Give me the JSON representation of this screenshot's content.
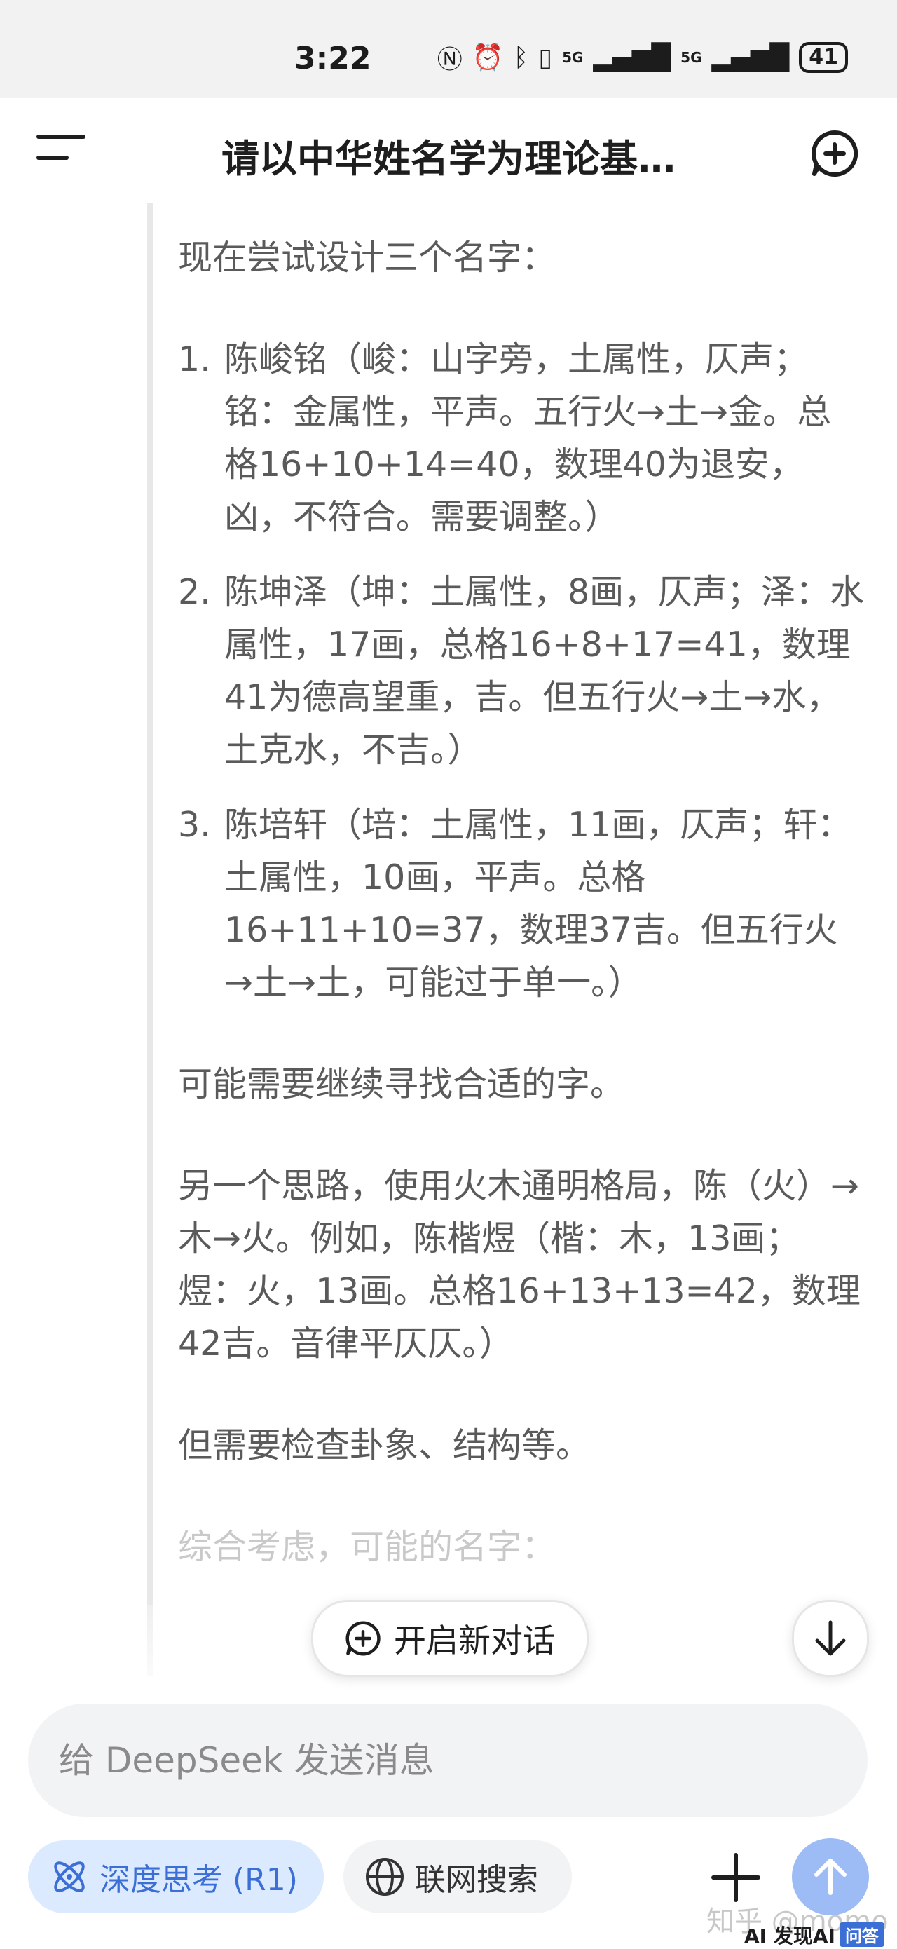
{
  "status_bar": {
    "time": "3:22",
    "icons": [
      "nfc-icon",
      "alarm-icon",
      "bluetooth-icon",
      "vibrate-icon",
      "signal-icon",
      "signal-icon"
    ],
    "network_1": "5G",
    "network_2": "5G",
    "battery": "41"
  },
  "header": {
    "title": "请以中华姓名学为理论基…"
  },
  "thinking": {
    "intro": "现在尝试设计三个名字：",
    "items": [
      {
        "num": "1.",
        "text": "陈峻铭（峻：山字旁，土属性，仄声；铭：金属性，平声。五行火→土→金。总格16+10+14=40，数理40为退安，凶，不符合。需要调整。）"
      },
      {
        "num": "2.",
        "text": "陈坤泽（坤：土属性，8画，仄声；泽：水属性，17画，总格16+8+17=41，数理41为德高望重，吉。但五行火→土→水，土克水，不吉。）"
      },
      {
        "num": "3.",
        "text": "陈培轩（培：土属性，11画，仄声；轩：土属性，10画，平声。总格16+11+10=37，数理37吉。但五行火→土→土，可能过于单一。）"
      }
    ],
    "p1": "可能需要继续寻找合适的字。",
    "p2": "另一个思路，使用火木通明格局，陈（火）→木→火。例如，陈楷煜（楷：木，13画；煜：火，13画。总格16+13+13=42，数理42吉。音律平仄仄。）",
    "p3": "但需要检查卦象、结构等。",
    "p4": "综合考虑，可能的名字："
  },
  "floating": {
    "new_chat_label": "开启新对话"
  },
  "input": {
    "placeholder": "给 DeepSeek 发送消息"
  },
  "bottom_bar": {
    "deep_think_label": "深度思考 (R1)",
    "web_search_label": "联网搜索"
  },
  "watermark": {
    "text": "知乎 @momo",
    "badge_ai": "AI 发现AI",
    "badge_qa": "问答"
  },
  "colors": {
    "accent": "#3b6fd6",
    "accent_bg": "#dbeafe",
    "send_button": "#9dbcf5",
    "input_bg": "#f2f3f5"
  }
}
